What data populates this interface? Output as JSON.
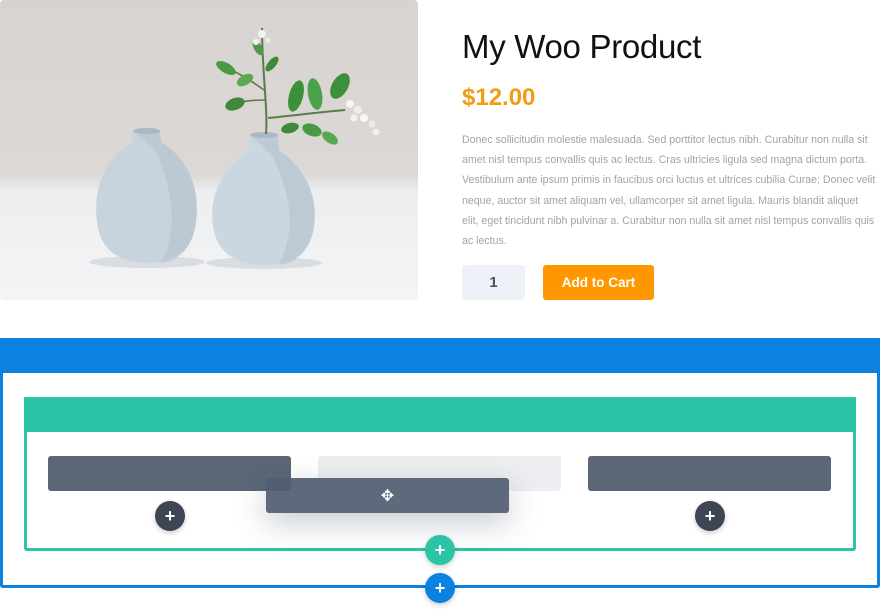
{
  "product": {
    "title": "My Woo Product",
    "price": "$12.00",
    "description": "Donec sollicitudin molestie malesuada. Sed porttitor lectus nibh. Curabitur non nulla sit amet nisl tempus convallis quis ac lectus. Cras ultricies ligula sed magna dictum porta. Vestibulum ante ipsum primis in faucibus orci luctus et ultrices cubilia Curae; Donec velit neque, auctor sit amet aliquam vel, ullamcorper sit amet ligula. Mauris blandit aliquet elit, eget tincidunt nibh pulvinar a. Curabitur non nulla sit amet nisl tempus convallis quis ac lectus.",
    "quantity": "1",
    "add_to_cart_label": "Add to Cart"
  },
  "builder": {
    "add_icon": "+",
    "move_icon": "✥"
  },
  "colors": {
    "price": "#f39c12",
    "cart_button": "#ff9800",
    "section": "#0c82e0",
    "row": "#2cc4a6",
    "module": "#5b6777"
  }
}
